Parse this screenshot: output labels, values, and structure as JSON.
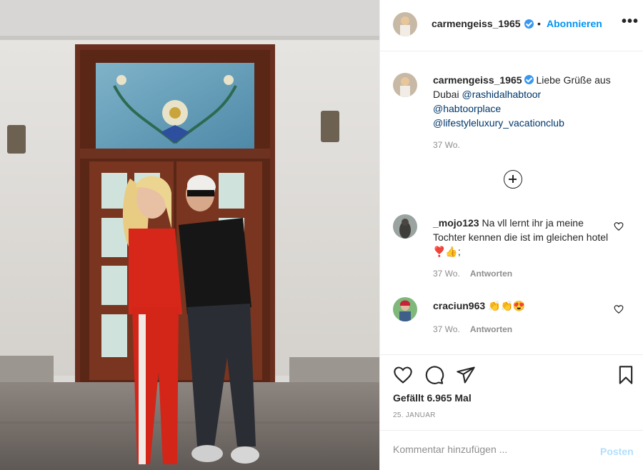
{
  "post": {
    "image_alt": "Photo of a couple standing in front of a wooden door",
    "header": {
      "username": "carmengeiss_1965",
      "dot": "•",
      "follow_label": "Abonnieren",
      "more_label": "•••"
    },
    "caption": {
      "username": "carmengeiss_1965",
      "text": "Liebe Grüße aus Dubai",
      "mentions": [
        "@rashidalhabtoor",
        "@habtoorplace",
        "@lifestyleluxury_vacationclub"
      ],
      "time": "37 Wo."
    },
    "comments": [
      {
        "username": "_mojo123",
        "text": "Na vll lernt ihr ja meine Tochter kennen die ist im gleichen hotel ❣️👍;",
        "time": "37 Wo.",
        "reply_label": "Antworten"
      },
      {
        "username": "craciun963",
        "text": "👏👏😍",
        "time": "37 Wo.",
        "reply_label": "Antworten"
      }
    ],
    "likes": "Gefällt 6.965 Mal",
    "date": "25. JANUAR",
    "comment_placeholder": "Kommentar hinzufügen ...",
    "post_label": "Posten"
  },
  "icons": [
    "heart-icon",
    "comment-icon",
    "share-icon",
    "bookmark-icon",
    "verified-badge-icon",
    "add-circle-icon",
    "more-options-icon"
  ],
  "colors": {
    "accent": "#0095f6",
    "mention": "#00376b",
    "muted": "#8e8e8e",
    "post_disabled": "#b2dffc",
    "verified": "#3897f0"
  }
}
